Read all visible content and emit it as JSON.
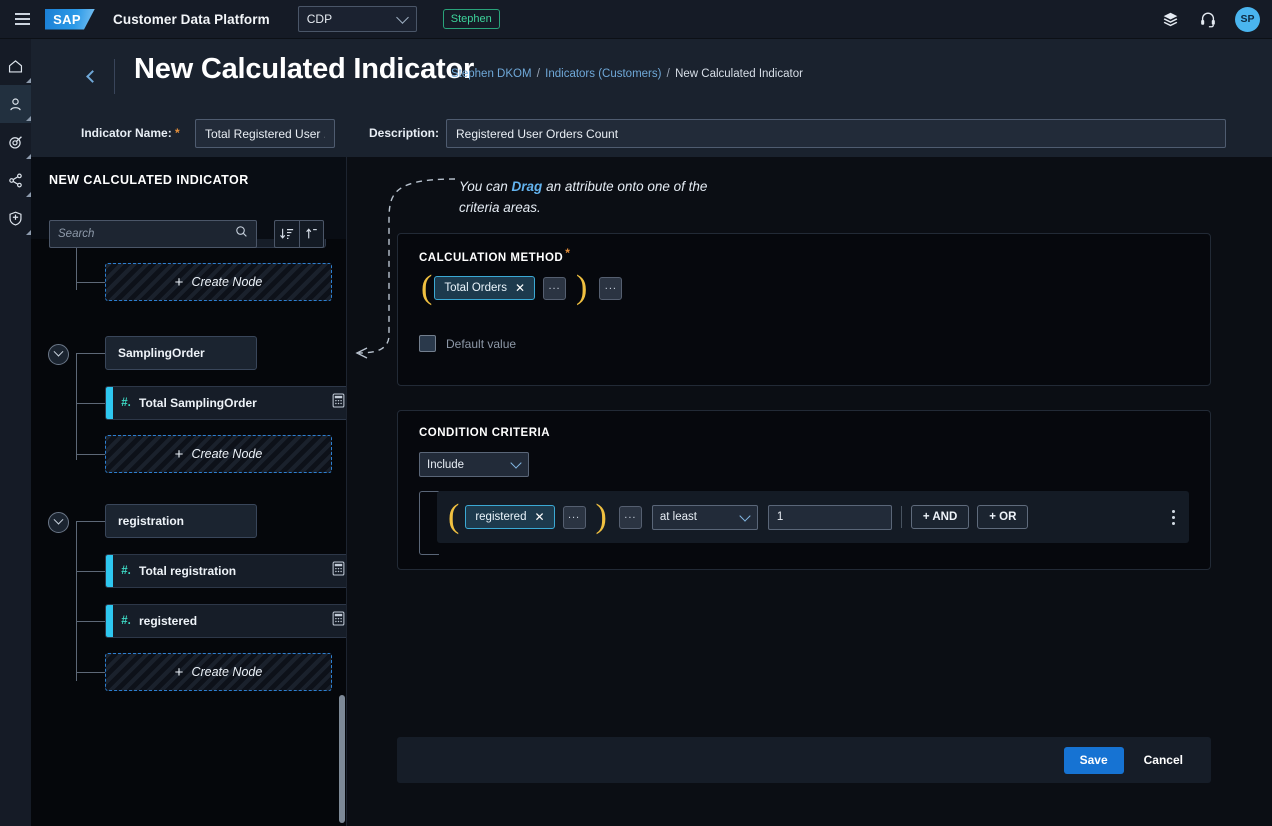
{
  "topbar": {
    "menu_icon": "hamburger-icon",
    "logo_text": "SAP",
    "app_title": "Customer Data Platform",
    "tenant": {
      "value": "CDP",
      "icon": "chevron-down-icon"
    },
    "user_tag": "Stephen",
    "layers_icon": "layers-icon",
    "support_icon": "headset-icon",
    "avatar_initials": "SP"
  },
  "rail": {
    "items": [
      {
        "name": "home-icon",
        "label": "Home"
      },
      {
        "name": "customer-icon",
        "label": "Customers"
      },
      {
        "name": "target-icon",
        "label": "Audiences"
      },
      {
        "name": "share-icon",
        "label": "Integrations"
      },
      {
        "name": "shield-icon",
        "label": "Privacy"
      }
    ]
  },
  "header": {
    "back_icon": "chevron-left-icon",
    "title": "New Calculated Indicator",
    "breadcrumb": {
      "root": "Stephen DKOM",
      "parent": "Indicators (Customers)",
      "current": "New Calculated Indicator",
      "separator": "/"
    },
    "fields": {
      "indicator_name_label": "Indicator Name:",
      "required_marker": "*",
      "indicator_name_value": "Total Registered User ...",
      "indicator_name_placeholder": "Indicator Name",
      "description_label": "Description:",
      "description_value": "Registered User Orders Count",
      "description_placeholder": "Description"
    }
  },
  "sidebar": {
    "title": "NEW CALCULATED INDICATOR",
    "search_placeholder": "Search",
    "search_value": "",
    "search_icon": "search-icon",
    "sort_icon": "sort-descending-icon",
    "collapse_icon": "collapse-all-icon",
    "create_node_label": "Create Node",
    "create_node_plus": "+",
    "tree": [
      {
        "type": "leaf-partial",
        "label": "",
        "hash": "#."
      },
      {
        "type": "create",
        "label": "Create Node"
      },
      {
        "type": "group",
        "label": "SamplingOrder",
        "toggle": "chevron-down-icon"
      },
      {
        "type": "leaf",
        "label": "Total SamplingOrder",
        "hash": "#.",
        "icon": "calculator-icon"
      },
      {
        "type": "create",
        "label": "Create Node"
      },
      {
        "type": "group",
        "label": "registration",
        "toggle": "chevron-down-icon"
      },
      {
        "type": "leaf",
        "label": "Total registration",
        "hash": "#.",
        "icon": "calculator-icon"
      },
      {
        "type": "leaf",
        "label": "registered",
        "hash": "#.",
        "icon": "calculator-icon"
      },
      {
        "type": "create",
        "label": "Create Node"
      }
    ]
  },
  "canvas": {
    "hint_prefix": "You can ",
    "hint_bold": "Drag",
    "hint_suffix": " an attribute onto one of the criteria areas.",
    "calculation_method": {
      "title": "CALCULATION METHOD",
      "required_marker": "*",
      "open_paren": "(",
      "close_paren": ")",
      "chip_label": "Total Orders",
      "chip_remove_icon": "close-icon",
      "inner_more_label": "...",
      "outer_more_label": "...",
      "default_value_label": "Default value",
      "default_value_checked": false
    },
    "condition_criteria": {
      "title": "CONDITION CRITERIA",
      "mode_value": "Include",
      "mode_icon": "chevron-down-icon",
      "open_paren": "(",
      "close_paren": ")",
      "chip_label": "registered",
      "chip_remove_icon": "close-icon",
      "inner_more_label": "...",
      "outer_more_label": "...",
      "operator_value": "at least",
      "operator_icon": "chevron-down-icon",
      "amount_value": "1",
      "amount_placeholder": "",
      "and_label": "+ AND",
      "or_label": "+ OR",
      "menu_icon": "kebab-menu-icon"
    },
    "footer": {
      "save_label": "Save",
      "cancel_label": "Cancel"
    }
  },
  "colors": {
    "accent_blue": "#1673d3",
    "chip_border": "#3ba9d4",
    "paren_yellow": "#f0c040",
    "tag_green": "#3dd39b",
    "leaf_bar": "#2ec7f0",
    "required_orange": "#e5903b"
  }
}
